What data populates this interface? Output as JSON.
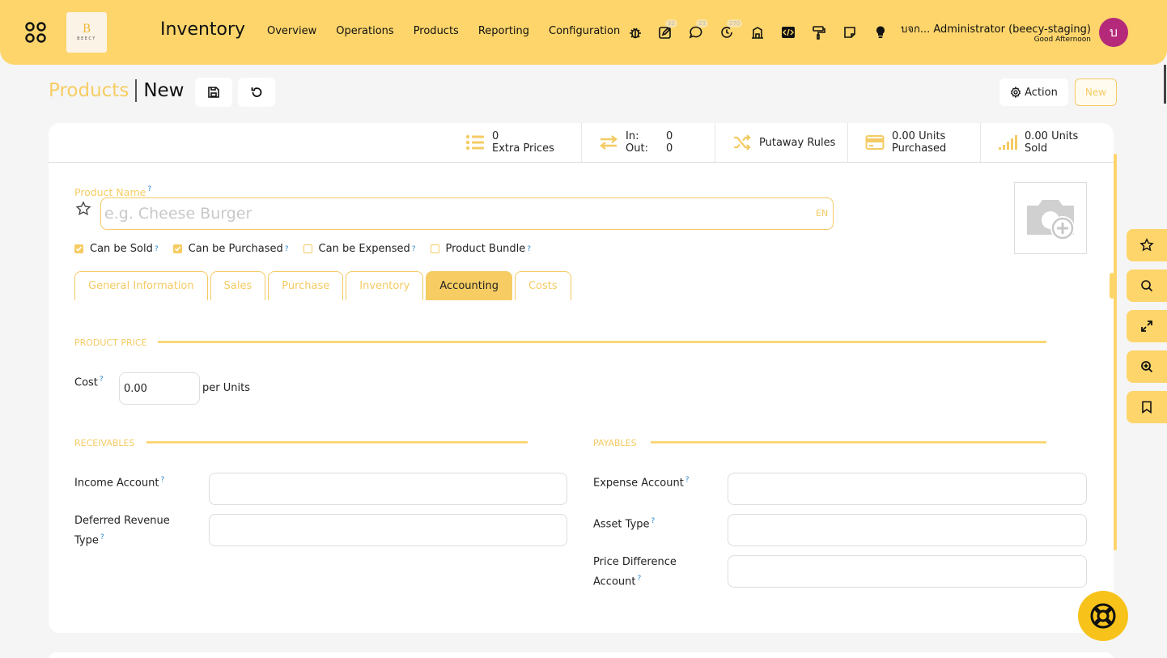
{
  "topbar": {
    "logo_letter": "B",
    "logo_word": "BEECY",
    "app_title": "Inventory",
    "menu": [
      "Overview",
      "Operations",
      "Products",
      "Reporting",
      "Configuration"
    ],
    "badges": {
      "activity": "32",
      "messages": "23",
      "timesheet": "270"
    },
    "user_name": "บจก... Administrator (beecy-staging)",
    "greeting": "Good Afternoon",
    "avatar_letter": "บ"
  },
  "breadcrumb": {
    "parent": "Products",
    "current": "New"
  },
  "control": {
    "action_label": "Action",
    "new_label": "New"
  },
  "stats": {
    "extra_prices_count": "0",
    "extra_prices_label": "Extra Prices",
    "in_label": "In:",
    "in_value": "0",
    "out_label": "Out:",
    "out_value": "0",
    "putaway_label": "Putaway Rules",
    "purchased_value": "0.00 Units",
    "purchased_label": "Purchased",
    "sold_value": "0.00 Units",
    "sold_label": "Sold"
  },
  "form": {
    "product_name_label": "Product Name",
    "product_name_placeholder": "e.g. Cheese Burger",
    "product_name_value": "",
    "lang": "EN",
    "help_mark": "?",
    "checkboxes": [
      {
        "label": "Can be Sold",
        "checked": true
      },
      {
        "label": "Can be Purchased",
        "checked": true
      },
      {
        "label": "Can be Expensed",
        "checked": false
      },
      {
        "label": "Product Bundle",
        "checked": false
      }
    ],
    "tabs": [
      "General Information",
      "Sales",
      "Purchase",
      "Inventory",
      "Accounting",
      "Costs"
    ],
    "active_tab": "Accounting"
  },
  "accounting": {
    "product_price_title": "PRODUCT PRICE",
    "cost_label": "Cost",
    "cost_value": "0.00",
    "per_units": "per Units",
    "receivables_title": "RECEIVABLES",
    "payables_title": "PAYABLES",
    "income_account_label": "Income Account",
    "deferred_revenue_label_1": "Deferred Revenue",
    "deferred_revenue_label_2": "Type",
    "expense_account_label": "Expense Account",
    "asset_type_label": "Asset Type",
    "price_diff_label_1": "Price Difference",
    "price_diff_label_2": "Account"
  },
  "colors": {
    "accent": "#fdd56b",
    "accent_text": "#f4cb63",
    "avatar": "#b5297a",
    "help": "#2d86c9"
  }
}
